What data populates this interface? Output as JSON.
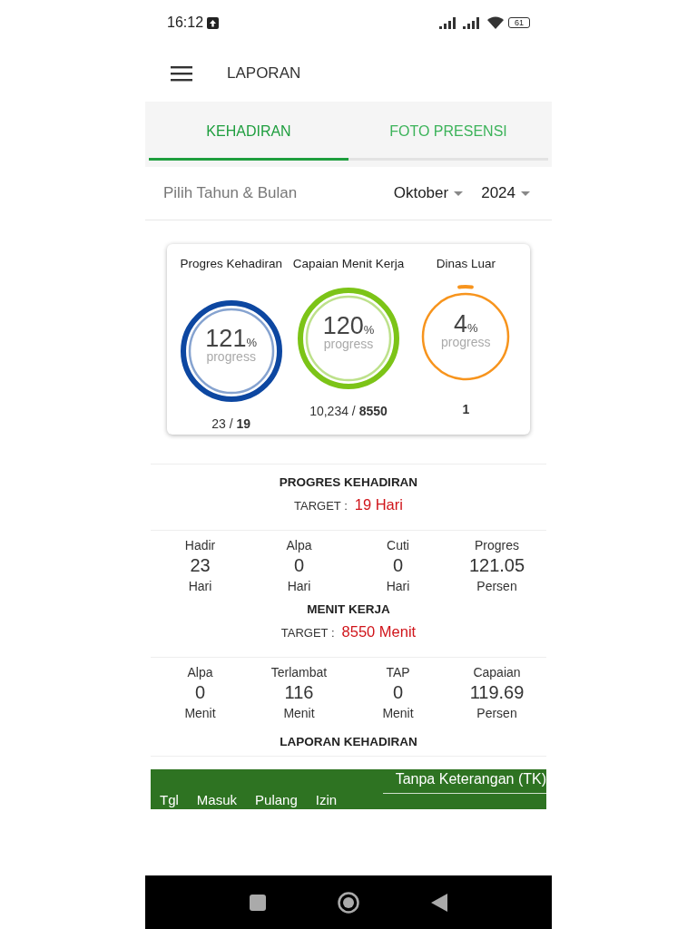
{
  "status_bar": {
    "time": "16:12",
    "battery": "61"
  },
  "app_bar": {
    "title": "LAPORAN"
  },
  "tabs": [
    {
      "label": "KEHADIRAN",
      "selected": true
    },
    {
      "label": "FOTO PRESENSI",
      "selected": false
    }
  ],
  "filter": {
    "label": "Pilih Tahun & Bulan",
    "month": "Oktober",
    "year": "2024"
  },
  "gauges": [
    {
      "title": "Progres Kehadiran",
      "value": "121",
      "unit": "%",
      "caption": "progress",
      "level": 1,
      "color": "#0d47a1",
      "actual": "23 /",
      "target": "19"
    },
    {
      "title": "Capaian Menit Kerja",
      "value": "120",
      "unit": "%",
      "caption": "progress",
      "level": 1,
      "color": "#7cc417",
      "actual": "10,234 /",
      "target": "8550"
    },
    {
      "title": "Dinas Luar",
      "value": "4",
      "unit": "%",
      "caption": "progress",
      "level": 0.04,
      "color": "#f7941d",
      "total": "1"
    }
  ],
  "sections": [
    {
      "title": "PROGRES KEHADIRAN",
      "target_label": "TARGET :",
      "target_value": "19 Hari",
      "stats": [
        {
          "label": "Hadir",
          "value": "23",
          "unit": "Hari"
        },
        {
          "label": "Alpa",
          "value": "0",
          "unit": "Hari"
        },
        {
          "label": "Cuti",
          "value": "0",
          "unit": "Hari"
        },
        {
          "label": "Progres",
          "value": "121.05",
          "unit": "Persen"
        }
      ]
    },
    {
      "title": "MENIT KERJA",
      "target_label": "TARGET :",
      "target_value": "8550 Menit",
      "stats": [
        {
          "label": "Alpa",
          "value": "0",
          "unit": "Menit"
        },
        {
          "label": "Terlambat",
          "value": "116",
          "unit": "Menit"
        },
        {
          "label": "TAP",
          "value": "0",
          "unit": "Menit"
        },
        {
          "label": "Capaian",
          "value": "119.69",
          "unit": "Persen"
        }
      ]
    }
  ],
  "report": {
    "title": "LAPORAN KEHADIRAN",
    "table": {
      "columns": [
        "Tgl",
        "Masuk",
        "Pulang",
        "Izin"
      ],
      "group_header": "Tanpa Keterangan (TK)"
    }
  }
}
